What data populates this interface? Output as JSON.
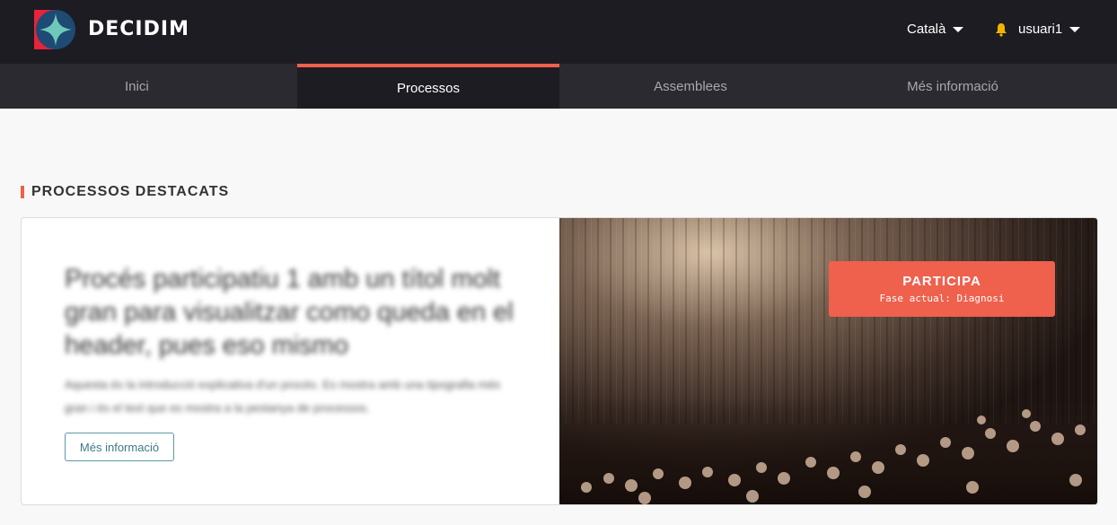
{
  "header": {
    "brand": "DECIDIM",
    "language": "Català",
    "user": "usuari1"
  },
  "nav": {
    "items": [
      {
        "label": "Inici"
      },
      {
        "label": "Processos"
      },
      {
        "label": "Assemblees"
      },
      {
        "label": "Més informació"
      }
    ],
    "active_index": 1
  },
  "highlighted": {
    "section_title": "PROCESSOS DESTACATS",
    "process_title": "Procés participatiu 1 amb un títol molt gran para visualitzar como queda en el header, pues eso mismo",
    "process_description": "Aquesta és la introducció explicativa d'un procés. Es mostra amb una tipografia més gran i és el text que es mostra a la pestanya de processos.",
    "more_info_label": "Més informació",
    "cta": {
      "label": "PARTICIPA",
      "phase": "Fase actual: Diagnosi"
    }
  },
  "colors": {
    "accent": "#ef604d",
    "topbar": "#1d1c22",
    "navbar": "#2b2a30",
    "link": "#3e7a87"
  },
  "icons": [
    "decidim-logo-icon",
    "caret-down-icon",
    "bell-icon"
  ]
}
